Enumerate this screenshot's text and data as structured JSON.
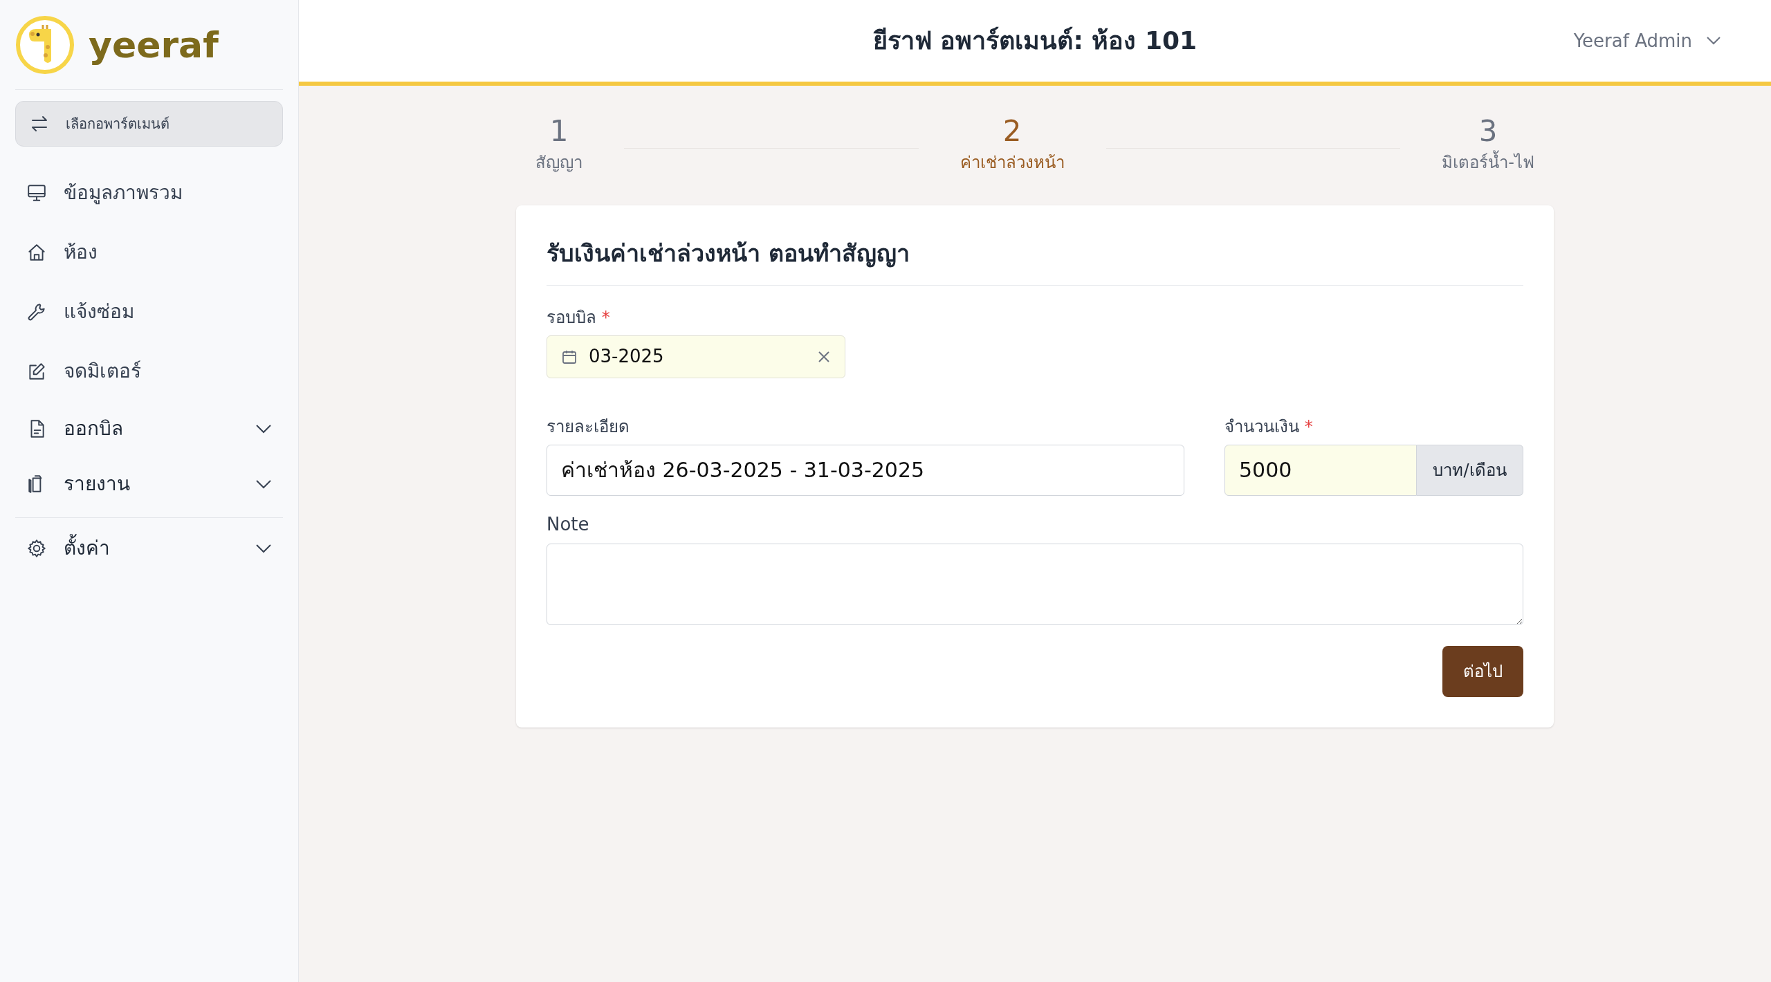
{
  "brand": {
    "name": "yeeraf"
  },
  "header": {
    "title": "ยีราฟ อพาร์ตเมนต์: ห้อง 101",
    "user": "Yeeraf Admin"
  },
  "sidebar": {
    "switch_button": "เลือกอพาร์ตเมนต์",
    "items": [
      {
        "label": "ข้อมูลภาพรวม",
        "expandable": false,
        "divider_before": false
      },
      {
        "label": "ห้อง",
        "expandable": false,
        "divider_before": false
      },
      {
        "label": "แจ้งซ่อม",
        "expandable": false,
        "divider_before": false
      },
      {
        "label": "จดมิเตอร์",
        "expandable": false,
        "divider_before": false
      },
      {
        "label": "ออกบิล",
        "expandable": true,
        "divider_before": false
      },
      {
        "label": "รายงาน",
        "expandable": true,
        "divider_before": false
      },
      {
        "label": "ตั้งค่า",
        "expandable": true,
        "divider_before": true
      }
    ]
  },
  "steps": [
    {
      "number": "1",
      "label": "สัญญา",
      "selected": false
    },
    {
      "number": "2",
      "label": "ค่าเช่าล่วงหน้า",
      "selected": true
    },
    {
      "number": "3",
      "label": "มิเตอร์น้ำ-ไฟ",
      "selected": false
    }
  ],
  "form": {
    "title": "รับเงินค่าเช่าล่วงหน้า ตอนทำสัญญา",
    "billing_period": {
      "label": "รอบบิล",
      "required_mark": "*",
      "value": "03-2025"
    },
    "detail": {
      "label": "รายละเอียด",
      "value": "ค่าเช่าห้อง 26-03-2025 - 31-03-2025"
    },
    "amount": {
      "label": "จำนวนเงิน",
      "required_mark": "*",
      "value": "5000",
      "suffix": "บาท/เดือน"
    },
    "note": {
      "label": "Note"
    },
    "submit": "ต่อไป"
  }
}
